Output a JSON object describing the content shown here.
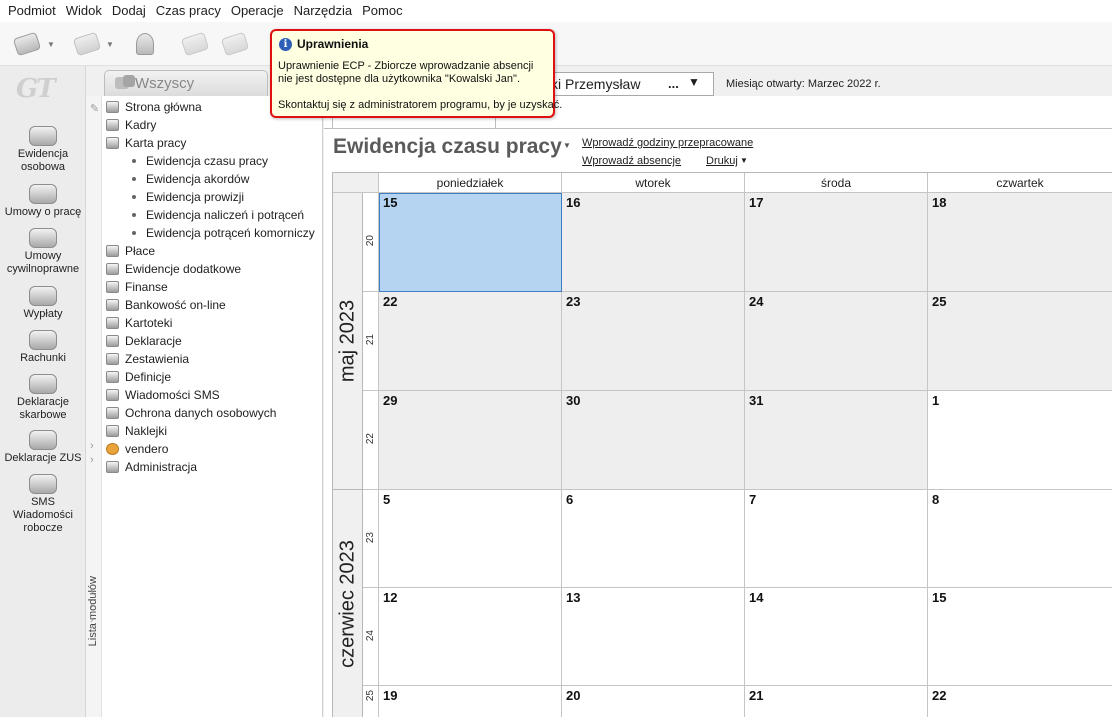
{
  "menu": [
    "Podmiot",
    "Widok",
    "Dodaj",
    "Czas pracy",
    "Operacje",
    "Narzędzia",
    "Pomoc"
  ],
  "toolbar": {
    "buttons": [
      "nav-back-icon",
      "nav-forward-icon",
      "stamp-icon",
      "tool-4-icon",
      "tool-5-icon"
    ]
  },
  "logo": "GT",
  "leftbar": [
    {
      "label": "Ewidencja osobowa",
      "icon": "people-icon"
    },
    {
      "label": "Umowy o pracę",
      "icon": "contract-icon"
    },
    {
      "label": "Umowy cywilnoprawne",
      "icon": "civil-contract-icon"
    },
    {
      "label": "Wypłaty",
      "icon": "payout-icon"
    },
    {
      "label": "Rachunki",
      "icon": "bill-icon"
    },
    {
      "label": "Deklaracje skarbowe",
      "icon": "tax-declaration-icon"
    },
    {
      "label": "Deklaracje ZUS",
      "icon": "zus-icon"
    },
    {
      "label": "SMS Wiadomości robocze",
      "icon": "sms-icon"
    }
  ],
  "modules": {
    "strip_label": "Lista modułów",
    "items": [
      {
        "label": "Strona główna",
        "type": "item"
      },
      {
        "label": "Kadry",
        "type": "item"
      },
      {
        "label": "Karta pracy",
        "type": "item"
      },
      {
        "label": "Ewidencja czasu pracy",
        "type": "sub"
      },
      {
        "label": "Ewidencja akordów",
        "type": "sub"
      },
      {
        "label": "Ewidencja prowizji",
        "type": "sub"
      },
      {
        "label": "Ewidencja naliczeń i potrąceń",
        "type": "sub"
      },
      {
        "label": "Ewidencja potrąceń komorniczy",
        "type": "sub"
      },
      {
        "label": "Płace",
        "type": "item"
      },
      {
        "label": "Ewidencje dodatkowe",
        "type": "item"
      },
      {
        "label": "Finanse",
        "type": "item"
      },
      {
        "label": "Bankowość on-line",
        "type": "item"
      },
      {
        "label": "Kartoteki",
        "type": "item"
      },
      {
        "label": "Deklaracje",
        "type": "item"
      },
      {
        "label": "Zestawienia",
        "type": "item"
      },
      {
        "label": "Definicje",
        "type": "item"
      },
      {
        "label": "Wiadomości SMS",
        "type": "item"
      },
      {
        "label": "Ochrona danych osobowych",
        "type": "item"
      },
      {
        "label": "Naklejki",
        "type": "item"
      },
      {
        "label": "vendero",
        "type": "item"
      },
      {
        "label": "Administracja",
        "type": "item"
      }
    ]
  },
  "filter_tab": "Wszyscy",
  "employee": {
    "name_fragment": "ki Przemysław",
    "more": "...",
    "month_open_label": "Miesiąc otwarty:",
    "month_open_value": "Marzec 2022 r."
  },
  "main": {
    "title": "Ewidencja czasu pracy",
    "link_hours": "Wprowadź godziny przepracowane",
    "link_absence": "Wprowadź absencje",
    "link_print": "Drukuj"
  },
  "calendar": {
    "weekdays": [
      "poniedziałek",
      "wtorek",
      "środa",
      "czwartek"
    ],
    "months": [
      {
        "label": "maj 2023",
        "weeks": 3
      },
      {
        "label": "czerwiec 2023",
        "weeks": 3
      }
    ],
    "weeks": [
      {
        "no": "20",
        "days": [
          "15",
          "16",
          "17",
          "18"
        ]
      },
      {
        "no": "21",
        "days": [
          "22",
          "23",
          "24",
          "25"
        ]
      },
      {
        "no": "22",
        "days": [
          "29",
          "30",
          "31",
          "1"
        ]
      },
      {
        "no": "23",
        "days": [
          "5",
          "6",
          "7",
          "8"
        ]
      },
      {
        "no": "24",
        "days": [
          "12",
          "13",
          "14",
          "15"
        ]
      },
      {
        "no": "25",
        "days": [
          "19",
          "20",
          "21",
          "22"
        ]
      }
    ],
    "selected": "15"
  },
  "tooltip": {
    "title": "Uprawnienia",
    "line1": "Uprawnienie ECP - Zbiorcze wprowadzanie absencji",
    "line2": "nie jest dostępne dla użytkownika \"Kowalski Jan\".",
    "line3": "Skontaktuj się z administratorem programu, by je uzyskać."
  }
}
